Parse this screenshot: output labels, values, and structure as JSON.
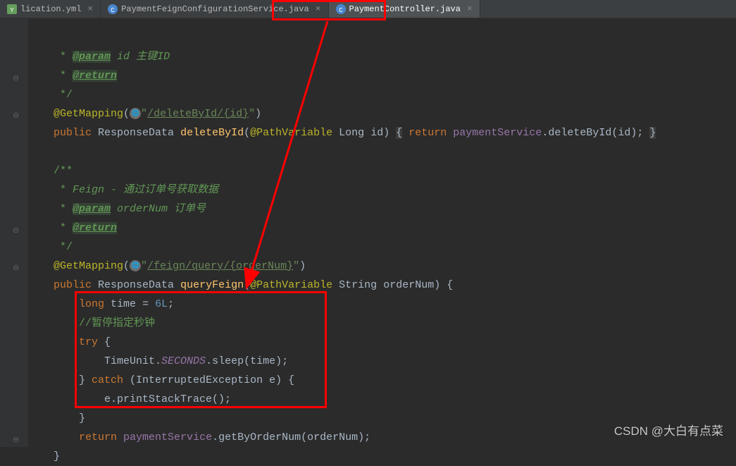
{
  "tabs": [
    {
      "label": "lication.yml",
      "icon_color": "#659e5c"
    },
    {
      "label": "PaymentFeignConfigurationService.java",
      "icon_color": "#4a86cf"
    },
    {
      "label": "PaymentController.java",
      "icon_color": "#4a86cf",
      "active": true
    }
  ],
  "code": {
    "l1_param": "@param",
    "l1_var": "id",
    "l1_desc": "主键ID",
    "l2_return": "@return",
    "l3_end": "*/",
    "l4_anno": "@GetMapping",
    "l4_url": "/deleteById/{id}",
    "l5_pub": "public",
    "l5_type": "ResponseData",
    "l5_method": "deleteById",
    "l5_pv": "@PathVariable",
    "l5_ptype": "Long",
    "l5_pname": "id",
    "l5_ret": "return",
    "l5_svc": "paymentService",
    "l5_call": "deleteById",
    "l5_arg": "id",
    "l7_start": "/**",
    "l8_feign": "Feign - 通过订单号获取数据",
    "l9_param": "@param",
    "l9_var": "orderNum",
    "l9_desc": "订单号",
    "l10_return": "@return",
    "l11_end": "*/",
    "l12_anno": "@GetMapping",
    "l12_url": "/feign/query/{orderNum}",
    "l13_pub": "public",
    "l13_type": "ResponseData",
    "l13_method": "queryFeign",
    "l13_pv": "@PathVariable",
    "l13_ptype": "String",
    "l13_pname": "orderNum",
    "l14_long": "long",
    "l14_var": "time",
    "l14_val": "6L",
    "l15_comment": "//暂停指定秒钟",
    "l16_try": "try",
    "l17_tu": "TimeUnit",
    "l17_sec": "SECONDS",
    "l17_sleep": "sleep",
    "l17_arg": "time",
    "l18_catch": "catch",
    "l18_ex": "InterruptedException",
    "l18_e": "e",
    "l19_call": "e.printStackTrace()",
    "l21_ret": "return",
    "l21_svc": "paymentService",
    "l21_call": "getByOrderNum",
    "l21_arg": "orderNum"
  },
  "watermark": "CSDN @大白有点菜",
  "icons": {
    "globe": "🌐",
    "close": "×",
    "java": "C",
    "yml": "Y"
  }
}
